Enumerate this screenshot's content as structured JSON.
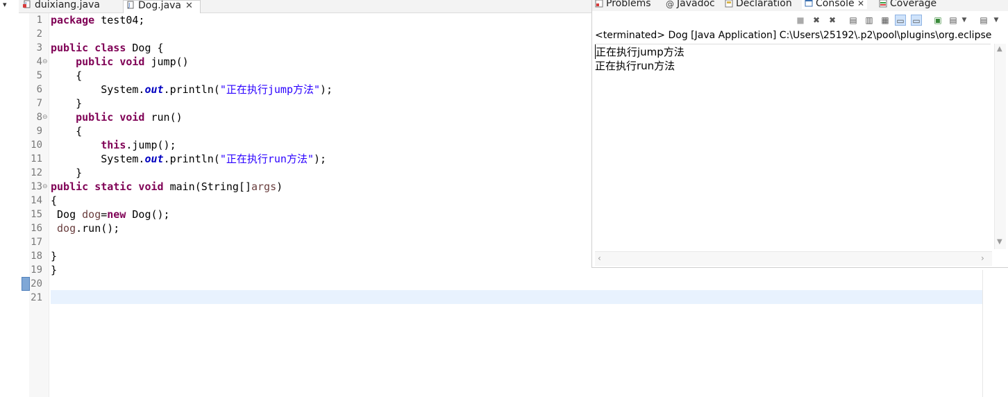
{
  "editor_tabs": [
    {
      "label": "duixiang.java",
      "active": false,
      "closable": false
    },
    {
      "label": "Dog.java",
      "active": true,
      "closable": true,
      "close_glyph": "✕"
    }
  ],
  "code": {
    "lines": [
      {
        "num": "1",
        "fold": ""
      },
      {
        "num": "2",
        "fold": ""
      },
      {
        "num": "3",
        "fold": ""
      },
      {
        "num": "4",
        "fold": "⊖"
      },
      {
        "num": "5",
        "fold": ""
      },
      {
        "num": "6",
        "fold": ""
      },
      {
        "num": "7",
        "fold": ""
      },
      {
        "num": "8",
        "fold": "⊖"
      },
      {
        "num": "9",
        "fold": ""
      },
      {
        "num": "10",
        "fold": ""
      },
      {
        "num": "11",
        "fold": ""
      },
      {
        "num": "12",
        "fold": ""
      },
      {
        "num": "13",
        "fold": "⊖"
      },
      {
        "num": "14",
        "fold": ""
      },
      {
        "num": "15",
        "fold": ""
      },
      {
        "num": "16",
        "fold": ""
      },
      {
        "num": "17",
        "fold": ""
      },
      {
        "num": "18",
        "fold": ""
      },
      {
        "num": "19",
        "fold": ""
      },
      {
        "num": "20",
        "fold": ""
      },
      {
        "num": "21",
        "fold": ""
      }
    ],
    "tokens": {
      "l1_kw": "package",
      "l1_rest": " test04;",
      "l3_kw": "public class",
      "l3_rest": " Dog {",
      "l4_kw": "public void",
      "l4_rest": " jump()",
      "l5": "{",
      "l6_a": "System.",
      "l6_fld": "out",
      "l6_b": ".println(",
      "l6_str": "\"正在执行jump方法\"",
      "l6_c": ");",
      "l7": "}",
      "l8_kw": "public void",
      "l8_rest": " run()",
      "l9": "{",
      "l10_kw": "this",
      "l10_rest": ".jump();",
      "l11_a": "System.",
      "l11_fld": "out",
      "l11_b": ".println(",
      "l11_str": "\"正在执行run方法\"",
      "l11_c": ");",
      "l12": "}",
      "l13_kw": "public static void",
      "l13_rest": " main(String[]",
      "l13_var": "args",
      "l13_end": ")",
      "l14": "{",
      "l15_a": "Dog ",
      "l15_var": "dog",
      "l15_b": "=",
      "l15_kw": "new",
      "l15_c": " Dog();",
      "l16_var": "dog",
      "l16_rest": ".run();",
      "l18": "}",
      "l19": "}"
    }
  },
  "console": {
    "tabs": [
      {
        "label": "Problems",
        "icon": "problems-icon"
      },
      {
        "label": "Javadoc",
        "icon": "at-icon"
      },
      {
        "label": "Declaration",
        "icon": "declaration-icon"
      },
      {
        "label": "Console",
        "icon": "console-icon",
        "active": true,
        "close_glyph": "✕"
      },
      {
        "label": "Coverage",
        "icon": "coverage-icon"
      }
    ],
    "status": "<terminated> Dog [Java Application] C:\\Users\\25192\\.p2\\pool\\plugins\\org.eclipse",
    "output": [
      "正在执行jump方法",
      "正在执行run方法"
    ]
  },
  "colors": {
    "keyword": "#7f0055",
    "string": "#2a00ff",
    "field": "#0000c0",
    "local_var": "#6a3e3e",
    "current_line": "#e8f2fe"
  }
}
